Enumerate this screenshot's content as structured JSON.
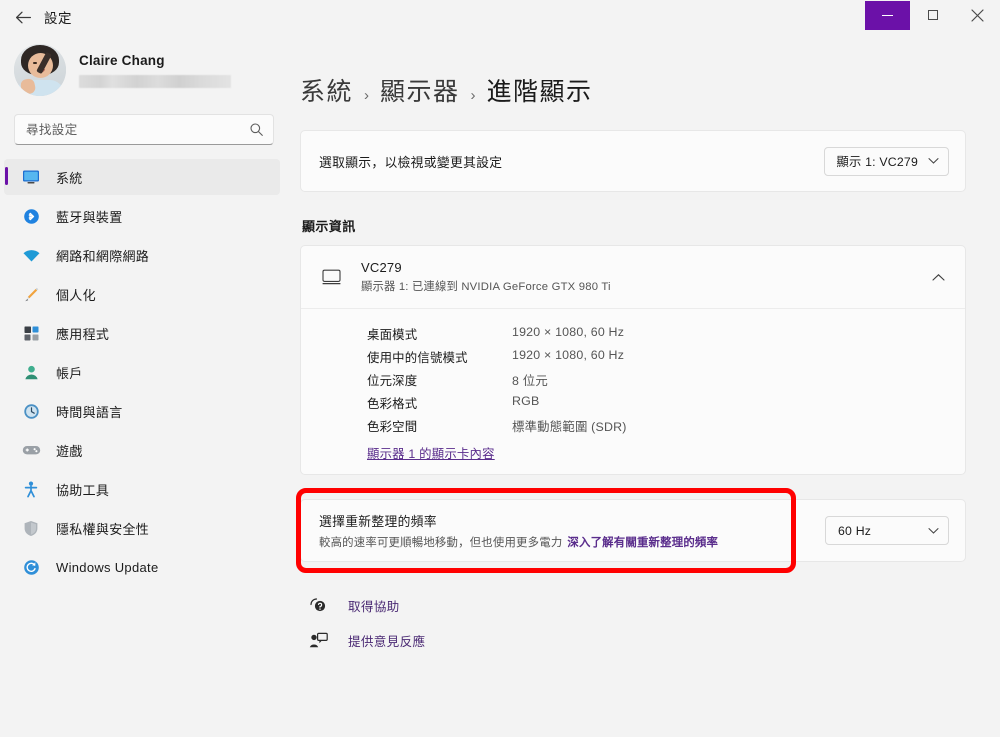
{
  "titlebar": {
    "back_label": "back-arrow",
    "app_title": "設定",
    "minimize_label": "—",
    "maximize_label": "□",
    "close_label": "✕",
    "accent_color": "#6B11A8"
  },
  "sidebar": {
    "profile": {
      "name": "Claire Chang",
      "email_masked": ""
    },
    "search": {
      "placeholder": "尋找設定",
      "value": ""
    },
    "items": [
      {
        "label": "系統",
        "icon": "monitor-icon",
        "active": true
      },
      {
        "label": "藍牙與裝置",
        "icon": "bluetooth-icon",
        "active": false
      },
      {
        "label": "網路和網際網路",
        "icon": "wifi-icon",
        "active": false
      },
      {
        "label": "個人化",
        "icon": "brush-icon",
        "active": false
      },
      {
        "label": "應用程式",
        "icon": "apps-icon",
        "active": false
      },
      {
        "label": "帳戶",
        "icon": "account-icon",
        "active": false
      },
      {
        "label": "時間與語言",
        "icon": "clock-icon",
        "active": false
      },
      {
        "label": "遊戲",
        "icon": "gamepad-icon",
        "active": false
      },
      {
        "label": "協助工具",
        "icon": "accessibility-icon",
        "active": false
      },
      {
        "label": "隱私權與安全性",
        "icon": "shield-icon",
        "active": false
      },
      {
        "label": "Windows Update",
        "icon": "update-icon",
        "active": false
      }
    ]
  },
  "content": {
    "breadcrumb": {
      "crumb1": "系統",
      "sep1": "›",
      "crumb2": "顯示器",
      "sep2": "›",
      "crumb3": "進階顯示"
    },
    "select_display": {
      "label": "選取顯示，以檢視或變更其設定",
      "dropdown_value": "顯示 1: VC279"
    },
    "section_title": "顯示資訊",
    "display_info": {
      "name": "VC279",
      "subtitle": "顯示器 1: 已連線到 NVIDIA GeForce GTX 980 Ti",
      "rows": [
        {
          "label": "桌面模式",
          "value": "1920 × 1080, 60 Hz"
        },
        {
          "label": "使用中的信號模式",
          "value": "1920 × 1080, 60 Hz"
        },
        {
          "label": "位元深度",
          "value": "8 位元"
        },
        {
          "label": "色彩格式",
          "value": "RGB"
        },
        {
          "label": "色彩空間",
          "value": "標準動態範圍 (SDR)"
        }
      ],
      "adapter_link": "顯示器 1 的顯示卡內容"
    },
    "refresh_rate": {
      "title": "選擇重新整理的頻率",
      "description": "較高的速率可更順暢地移動，但也使用更多電力",
      "learn_more": "深入了解有關重新整理的頻率",
      "dropdown_value": "60 Hz",
      "highlight_color": "#FF0000"
    },
    "links": [
      {
        "label": "取得協助",
        "icon": "help-icon"
      },
      {
        "label": "提供意見反應",
        "icon": "feedback-icon"
      }
    ]
  }
}
